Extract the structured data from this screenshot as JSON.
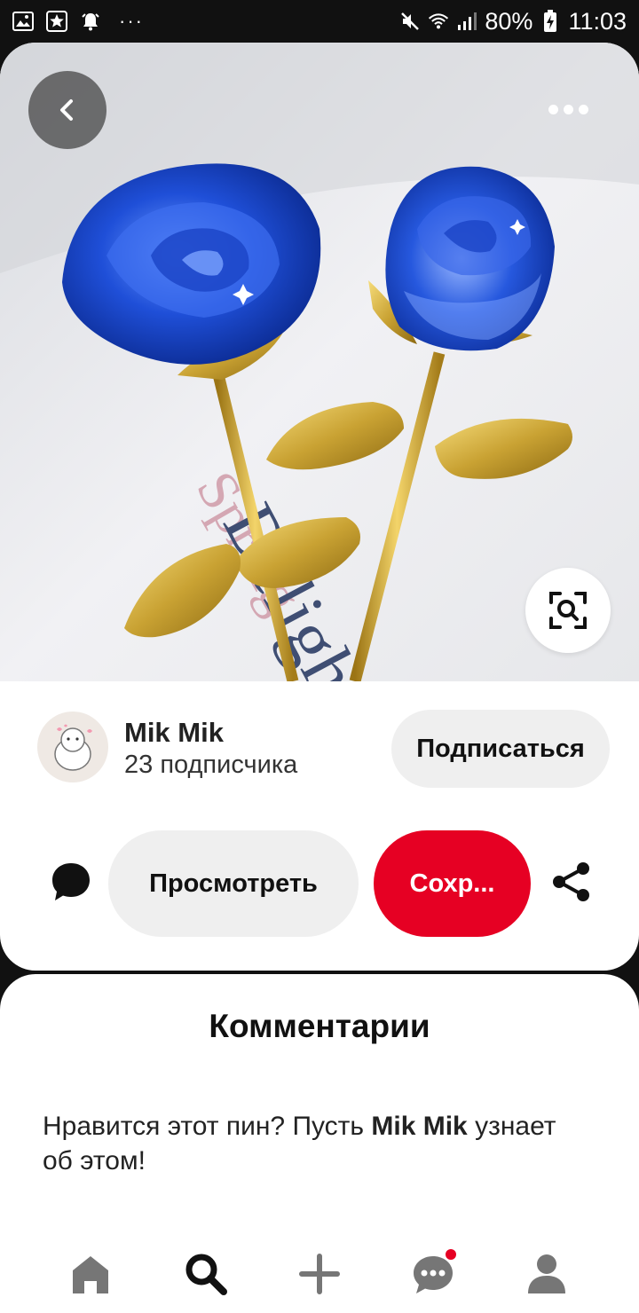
{
  "status_bar": {
    "battery": "80%",
    "time": "11:03",
    "more": "···"
  },
  "pin": {
    "image_alt": "Blue glass roses with golden stems",
    "image_text": "Spring Delight"
  },
  "creator": {
    "name": "Mik Mik",
    "followers": "23 подписчика",
    "follow_label": "Подписаться"
  },
  "actions": {
    "view_label": "Просмотреть",
    "save_label": "Сохр..."
  },
  "comments": {
    "title": "Комментарии",
    "prompt_before": "Нравится этот пин? Пусть ",
    "prompt_name": "Mik Mik",
    "prompt_after": " узнает об этом!"
  },
  "colors": {
    "save": "#e60023",
    "button_gray": "#efefef",
    "rose_blue": "#1f4fd8",
    "gold": "#c9a233"
  },
  "nav": {
    "items": [
      "home-icon",
      "search-icon",
      "create-icon",
      "messages-icon",
      "profile-icon"
    ]
  }
}
